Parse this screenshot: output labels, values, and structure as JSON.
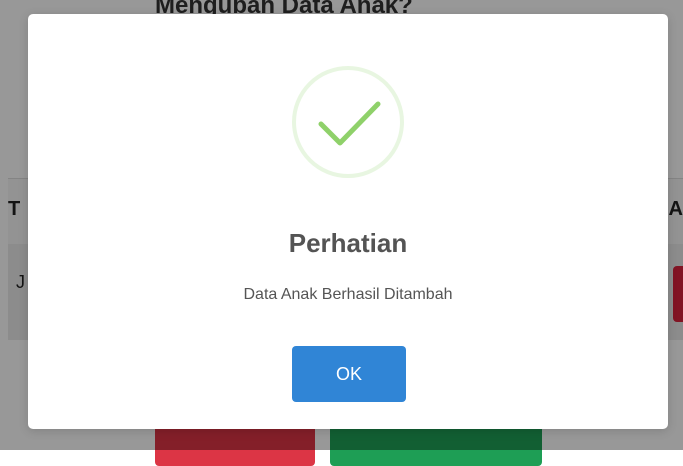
{
  "background": {
    "title": "Mengubah Data Anak?",
    "table_header_first": "T",
    "table_header_last": "A",
    "row_first_cell": "J"
  },
  "dialog": {
    "icon": "success-check-icon",
    "title": "Perhatian",
    "message": "Data Anak Berhasil Ditambah",
    "ok_label": "OK"
  },
  "colors": {
    "confirm_button": "#3085d6",
    "success_check": "#8fd16a",
    "success_ring": "#e3f3da",
    "danger_button": "#dc3545",
    "success_button": "#1e9e55"
  }
}
